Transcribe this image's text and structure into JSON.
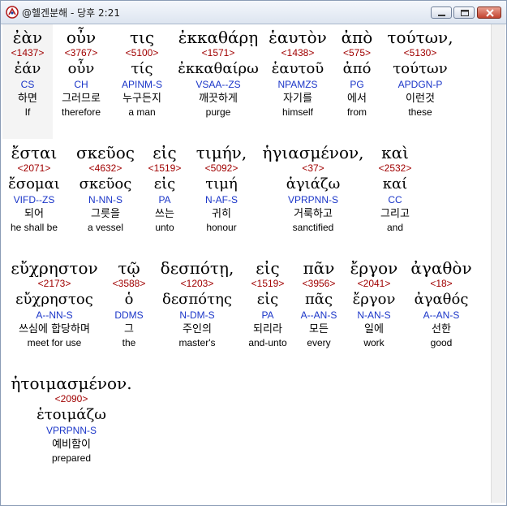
{
  "window": {
    "title": "@헬겐분해 - 당후 2:21",
    "icon": "app-logo-icon",
    "controls": [
      "minimize-icon",
      "maximize-icon",
      "close-icon"
    ]
  },
  "colors": {
    "strongs": "#a00000",
    "parsing": "#1a35c8",
    "text": "#000000",
    "highlight": "#f4f4f4"
  },
  "rows": [
    {
      "words": [
        {
          "greek": "ἐὰν",
          "strongs": "<1437>",
          "lemma": "ἐάν",
          "parse": "CS",
          "korean": "하면",
          "english": "If"
        },
        {
          "greek": "οὖν",
          "strongs": "<3767>",
          "lemma": "οὖν",
          "parse": "CH",
          "korean": "그러므로",
          "english": "therefore"
        },
        {
          "greek": "τις",
          "strongs": "<5100>",
          "lemma": "τίς",
          "parse": "APINM-S",
          "korean": "누구든지",
          "english": "a man"
        },
        {
          "greek": "ἐκκαθάρῃ",
          "strongs": "<1571>",
          "lemma": "ἐκκαθαίρω",
          "parse": "VSAA--ZS",
          "korean": "깨끗하게",
          "english": "purge"
        },
        {
          "greek": "ἑαυτὸν",
          "strongs": "<1438>",
          "lemma": "ἑαυτοῦ",
          "parse": "NPAMZS",
          "korean": "자기를",
          "english": "himself"
        },
        {
          "greek": "ἀπὸ",
          "strongs": "<575>",
          "lemma": "ἀπό",
          "parse": "PG",
          "korean": "에서",
          "english": "from"
        },
        {
          "greek": "τούτων,",
          "strongs": "<5130>",
          "lemma": "τούτων",
          "parse": "APDGN-P",
          "korean": "이런것",
          "english": "these"
        }
      ]
    },
    {
      "words": [
        {
          "greek": "ἔσται",
          "strongs": "<2071>",
          "lemma": "ἔσομαι",
          "parse": "VIFD--ZS",
          "korean": "되어",
          "english": "he shall be"
        },
        {
          "greek": "σκεῦος",
          "strongs": "<4632>",
          "lemma": "σκεῦος",
          "parse": "N-NN-S",
          "korean": "그릇을",
          "english": "a vessel"
        },
        {
          "greek": "εἰς",
          "strongs": "<1519>",
          "lemma": "εἰς",
          "parse": "PA",
          "korean": "쓰는",
          "english": "unto"
        },
        {
          "greek": "τιμήν,",
          "strongs": "<5092>",
          "lemma": "τιμή",
          "parse": "N-AF-S",
          "korean": "귀히",
          "english": "honour"
        },
        {
          "greek": "ἡγιασμένον,",
          "strongs": "<37>",
          "lemma": "ἁγιάζω",
          "parse": "VPRPNN-S",
          "korean": "거룩하고",
          "english": "sanctified"
        },
        {
          "greek": "καὶ",
          "strongs": "<2532>",
          "lemma": "καί",
          "parse": "CC",
          "korean": "그리고",
          "english": "and"
        }
      ]
    },
    {
      "words": [
        {
          "greek": "εὔχρηστον",
          "strongs": "<2173>",
          "lemma": "εὔχρηστος",
          "parse": "A--NN-S",
          "korean": "쓰심에 합당하며",
          "english": "meet for use"
        },
        {
          "greek": "τῷ",
          "strongs": "<3588>",
          "lemma": "ὁ",
          "parse": "DDMS",
          "korean": "그",
          "english": "the"
        },
        {
          "greek": "δεσπότῃ,",
          "strongs": "<1203>",
          "lemma": "δεσπότης",
          "parse": "N-DM-S",
          "korean": "주인의",
          "english": "master's"
        },
        {
          "greek": "εἰς",
          "strongs": "<1519>",
          "lemma": "εἰς",
          "parse": "PA",
          "korean": "되리라",
          "english": "and-unto"
        },
        {
          "greek": "πᾶν",
          "strongs": "<3956>",
          "lemma": "πᾶς",
          "parse": "A--AN-S",
          "korean": "모든",
          "english": "every"
        },
        {
          "greek": "ἔργον",
          "strongs": "<2041>",
          "lemma": "ἔργον",
          "parse": "N-AN-S",
          "korean": "일에",
          "english": "work"
        },
        {
          "greek": "ἀγαθὸν",
          "strongs": "<18>",
          "lemma": "ἀγαθός",
          "parse": "A--AN-S",
          "korean": "선한",
          "english": "good"
        }
      ]
    },
    {
      "words": [
        {
          "greek": "ἡτοιμασμένον.",
          "strongs": "<2090>",
          "lemma": "ἑτοιμάζω",
          "parse": "VPRPNN-S",
          "korean": "예비함이",
          "english": "prepared"
        }
      ]
    }
  ]
}
